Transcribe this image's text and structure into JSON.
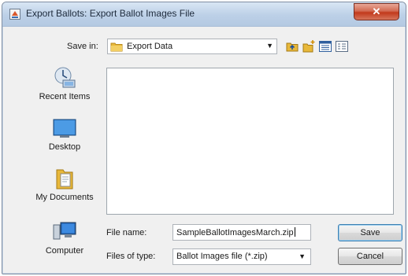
{
  "window": {
    "title": "Export Ballots: Export Ballot Images File",
    "close_glyph": "✕"
  },
  "save_in": {
    "label": "Save in:",
    "value": "Export Data",
    "dropdown_arrow": "▼"
  },
  "toolbar": {
    "icons": [
      "up-one-level-icon",
      "new-folder-icon",
      "list-view-icon",
      "details-view-icon"
    ]
  },
  "places": [
    {
      "label": "Recent Items",
      "icon": "recent-items-icon"
    },
    {
      "label": "Desktop",
      "icon": "desktop-icon"
    },
    {
      "label": "My Documents",
      "icon": "my-documents-icon"
    },
    {
      "label": "Computer",
      "icon": "computer-icon"
    }
  ],
  "file_name": {
    "label": "File name:",
    "value": "SampleBallotImagesMarch.zip"
  },
  "file_type": {
    "label": "Files of type:",
    "value": "Ballot Images file (*.zip)",
    "dropdown_arrow": "▼"
  },
  "buttons": {
    "save": "Save",
    "cancel": "Cancel"
  },
  "colors": {
    "titlebar": "#bcd0e7",
    "close_button": "#c2391b",
    "folder": "#e8b83a"
  }
}
